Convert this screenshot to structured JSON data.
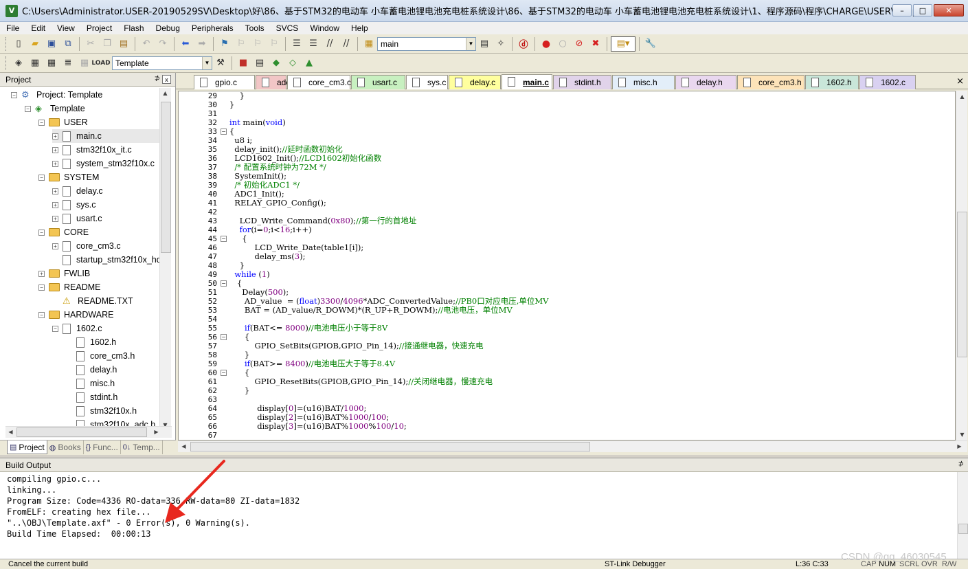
{
  "window": {
    "icon_letter": "V",
    "title": "C:\\Users\\Administrator.USER-20190529SV\\Desktop\\好\\86、基于STM32的电动车 小车蓄电池锂电池充电桩系统设计\\86、基于STM32的电动车 小车蓄电池锂电池充电桩系统设计\\1、程序源码\\程序\\CHARGE\\USER\\Template.uvprojx -...",
    "min_label": "–",
    "max_label": "□",
    "close_label": "✕"
  },
  "menu": [
    "File",
    "Edit",
    "View",
    "Project",
    "Flash",
    "Debug",
    "Peripherals",
    "Tools",
    "SVCS",
    "Window",
    "Help"
  ],
  "toolbar": {
    "find_value": "main",
    "target_value": "Template"
  },
  "project_panel": {
    "title": "Project",
    "pin": "⊅",
    "close": "x",
    "tree": [
      {
        "label": "Project: Template",
        "type": "project",
        "exp": "−"
      },
      {
        "label": "Template",
        "type": "target",
        "exp": "−"
      },
      {
        "label": "USER",
        "type": "folder",
        "exp": "−"
      },
      {
        "label": "main.c",
        "type": "file",
        "exp": "+",
        "selected": true
      },
      {
        "label": "stm32f10x_it.c",
        "type": "file",
        "exp": "+"
      },
      {
        "label": "system_stm32f10x.c",
        "type": "file",
        "exp": "+"
      },
      {
        "label": "SYSTEM",
        "type": "folder",
        "exp": "−"
      },
      {
        "label": "delay.c",
        "type": "file",
        "exp": "+"
      },
      {
        "label": "sys.c",
        "type": "file",
        "exp": "+"
      },
      {
        "label": "usart.c",
        "type": "file",
        "exp": "+"
      },
      {
        "label": "CORE",
        "type": "folder",
        "exp": "−"
      },
      {
        "label": "core_cm3.c",
        "type": "file",
        "exp": "+"
      },
      {
        "label": "startup_stm32f10x_hd.",
        "type": "file",
        "exp": ""
      },
      {
        "label": "FWLIB",
        "type": "folder",
        "exp": "+"
      },
      {
        "label": "README",
        "type": "folder",
        "exp": "−"
      },
      {
        "label": "README.TXT",
        "type": "warn",
        "exp": ""
      },
      {
        "label": "HARDWARE",
        "type": "folder",
        "exp": "−"
      },
      {
        "label": "1602.c",
        "type": "file",
        "exp": "−"
      },
      {
        "label": "1602.h",
        "type": "file",
        "exp": ""
      },
      {
        "label": "core_cm3.h",
        "type": "file",
        "exp": ""
      },
      {
        "label": "delay.h",
        "type": "file",
        "exp": ""
      },
      {
        "label": "misc.h",
        "type": "file",
        "exp": ""
      },
      {
        "label": "stdint.h",
        "type": "file",
        "exp": ""
      },
      {
        "label": "stm32f10x.h",
        "type": "file",
        "exp": ""
      },
      {
        "label": "stm32f10x_adc.h",
        "type": "file",
        "exp": ""
      }
    ],
    "tabs": [
      {
        "label": "Project",
        "icon": "▤",
        "active": true
      },
      {
        "label": "Books",
        "icon": "◍"
      },
      {
        "label": "Func...",
        "icon": "{}"
      },
      {
        "label": "Temp...",
        "icon": "0↓"
      }
    ]
  },
  "editor": {
    "tabs": [
      {
        "label": "gpio.c",
        "color": "#ffffff"
      },
      {
        "label": "adc.c",
        "color": "#f2c6c6"
      },
      {
        "label": "core_cm3.c",
        "color": "#ffffff"
      },
      {
        "label": "usart.c",
        "color": "#c8f0c0"
      },
      {
        "label": "sys.c",
        "color": "#ffffff"
      },
      {
        "label": "delay.c",
        "color": "#ffff9e"
      },
      {
        "label": "main.c",
        "color": "#ffffff",
        "active": true
      },
      {
        "label": "stdint.h",
        "color": "#e1d3ea"
      },
      {
        "label": "misc.h",
        "color": "#e3eef9"
      },
      {
        "label": "delay.h",
        "color": "#e9d7ef"
      },
      {
        "label": "core_cm3.h",
        "color": "#fde3b9"
      },
      {
        "label": "1602.h",
        "color": "#c9e6d9"
      },
      {
        "label": "1602.c",
        "color": "#d9d1f1"
      }
    ],
    "tab_close": "×",
    "lines": [
      {
        "n": "29",
        "t": "    }"
      },
      {
        "n": "30",
        "t": "}"
      },
      {
        "n": "31",
        "t": ""
      },
      {
        "n": "32",
        "t": "int main(void)"
      },
      {
        "n": "33",
        "t": "{",
        "fold": "−"
      },
      {
        "n": "34",
        "t": "  u8 i;"
      },
      {
        "n": "35",
        "t": "  delay_init();//延时函数初始化"
      },
      {
        "n": "36",
        "t": "  LCD1602_Init();//LCD1602初始化函数"
      },
      {
        "n": "37",
        "t": "  /* 配置系统时钟为72M */"
      },
      {
        "n": "38",
        "t": "  SystemInit();"
      },
      {
        "n": "39",
        "t": "  /* 初始化ADC1 */"
      },
      {
        "n": "40",
        "t": "  ADC1_Init();"
      },
      {
        "n": "41",
        "t": "  RELAY_GPIO_Config();"
      },
      {
        "n": "42",
        "t": ""
      },
      {
        "n": "43",
        "t": "    LCD_Write_Command(0x80);//第一行的首地址"
      },
      {
        "n": "44",
        "t": "    for(i=0;i<16;i++)"
      },
      {
        "n": "45",
        "t": "     {",
        "fold": "−"
      },
      {
        "n": "46",
        "t": "          LCD_Write_Date(table1[i]);"
      },
      {
        "n": "47",
        "t": "          delay_ms(3);"
      },
      {
        "n": "48",
        "t": "    }"
      },
      {
        "n": "49",
        "t": "  while (1)"
      },
      {
        "n": "50",
        "t": "   {",
        "fold": "−"
      },
      {
        "n": "51",
        "t": "     Delay(500);"
      },
      {
        "n": "52",
        "t": "      AD_value  = (float)3300/4096*ADC_ConvertedValue;//PB0口对应电压,单位MV"
      },
      {
        "n": "53",
        "t": "      BAT = (AD_value/R_DOWM)*(R_UP+R_DOWM);//电池电压，单位MV"
      },
      {
        "n": "54",
        "t": ""
      },
      {
        "n": "55",
        "t": "      if(BAT<= 8000)//电池电压小于等于8V"
      },
      {
        "n": "56",
        "t": "      {",
        "fold": "−"
      },
      {
        "n": "57",
        "t": "          GPIO_SetBits(GPIOB,GPIO_Pin_14);//接通继电器，快速充电"
      },
      {
        "n": "58",
        "t": "      }"
      },
      {
        "n": "59",
        "t": "      if(BAT>= 8400)//电池电压大于等于8.4V"
      },
      {
        "n": "60",
        "t": "      {",
        "fold": "−"
      },
      {
        "n": "61",
        "t": "          GPIO_ResetBits(GPIOB,GPIO_Pin_14);//关闭继电器，慢速充电"
      },
      {
        "n": "62",
        "t": "      }"
      },
      {
        "n": "63",
        "t": ""
      },
      {
        "n": "64",
        "t": "           display[0]=(u16)BAT/1000;"
      },
      {
        "n": "65",
        "t": "           display[2]=(u16)BAT%1000/100;"
      },
      {
        "n": "66",
        "t": "           display[3]=(u16)BAT%1000%100/10;"
      },
      {
        "n": "67",
        "t": ""
      }
    ]
  },
  "build_output": {
    "title": "Build Output",
    "lines": [
      "compiling gpio.c...",
      "linking...",
      "Program Size: Code=4336 RO-data=336 RW-data=80 ZI-data=1832",
      "FromELF: creating hex file...",
      "\"..\\OBJ\\Template.axf\" - 0 Error(s), 0 Warning(s).",
      "Build Time Elapsed:  00:00:13"
    ]
  },
  "status": {
    "left": "Cancel the current build",
    "debugger": "ST-Link Debugger",
    "position": "L:36 C:33",
    "indicators": [
      "CAP",
      "NUM",
      "SCRL",
      "OVR",
      "R/W"
    ]
  },
  "watermark": "CSDN @qq_46030545",
  "colors": {
    "keyword": "#0000ff",
    "comment": "#008000",
    "number": "#800080",
    "annotation_arrow": "#e8281e"
  }
}
